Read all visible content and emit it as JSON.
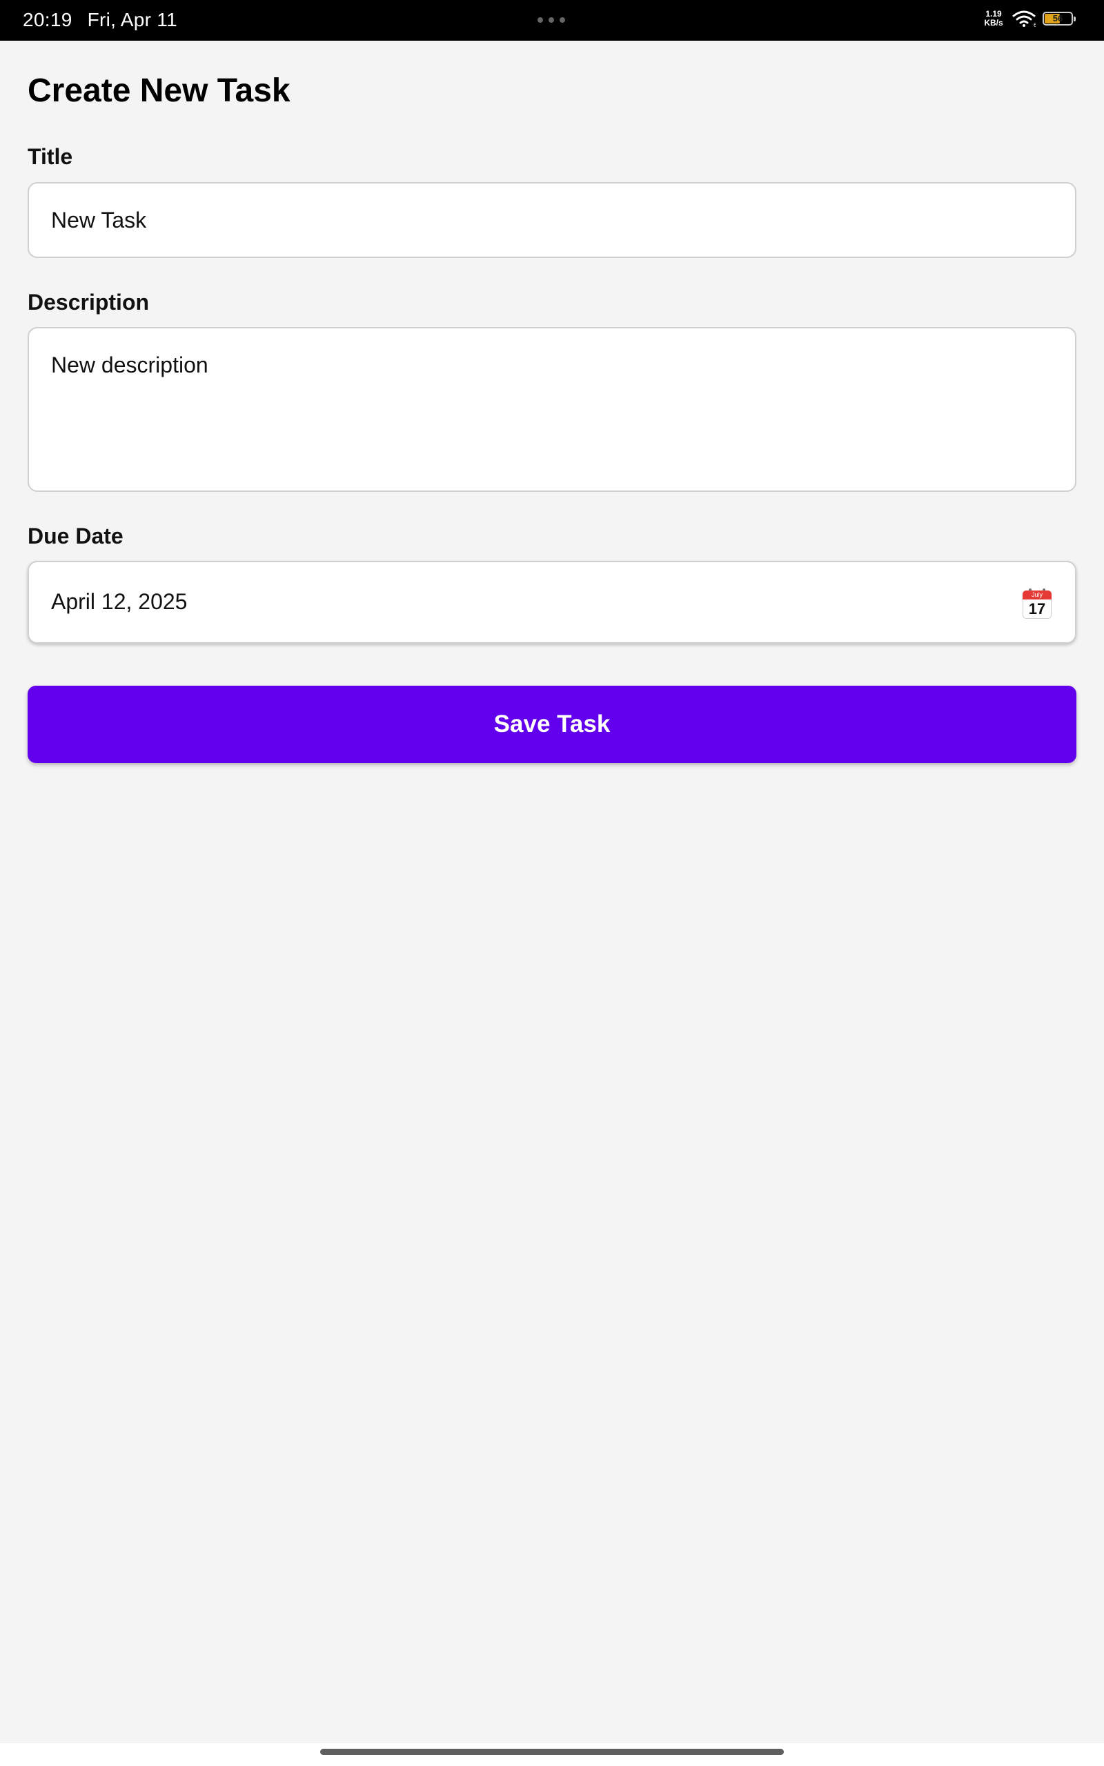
{
  "status_bar": {
    "time": "20:19",
    "date": "Fri, Apr 11",
    "net_speed_value": "1.19",
    "net_speed_unit": "KB/s",
    "battery_level": "56",
    "battery_color": "#e0a31a"
  },
  "form": {
    "title": "Create New Task",
    "title_label": "Title",
    "title_value": "New Task",
    "description_label": "Description",
    "description_value": "New description",
    "due_date_label": "Due Date",
    "due_date_value": "April 12, 2025",
    "calendar_icon": {
      "name": "calendar-icon",
      "month": "July",
      "day": "17"
    },
    "save_label": "Save Task"
  },
  "colors": {
    "accent": "#6200ee",
    "background": "#f4f4f4",
    "status_bar": "#000000"
  }
}
